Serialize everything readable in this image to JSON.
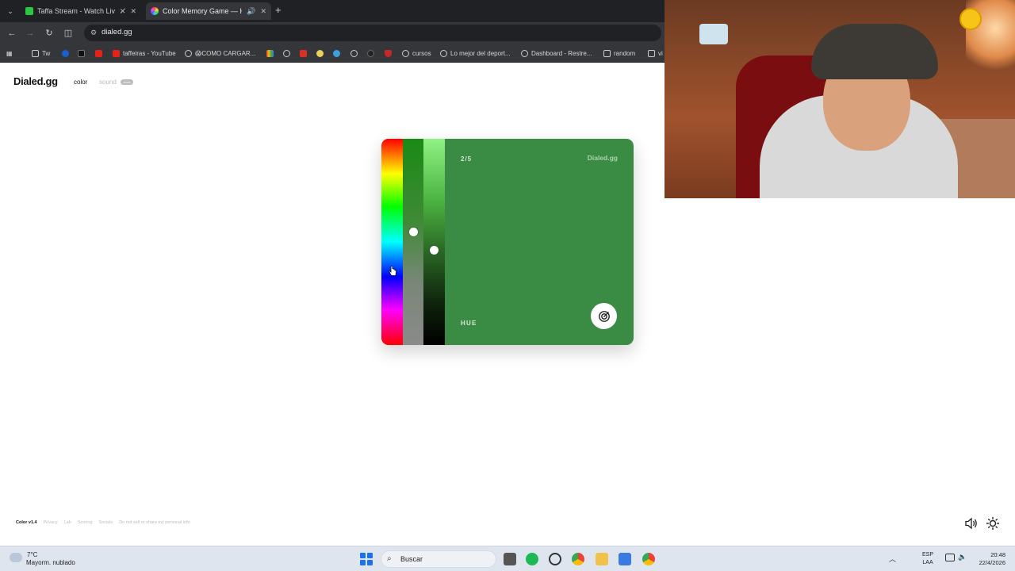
{
  "browser": {
    "tabs": [
      {
        "title": "Taffa Stream - Watch Live o",
        "favicon_color": "#28c840",
        "muted": true,
        "active": false
      },
      {
        "title": "Color Memory Game — Ho",
        "favicon_color": "#e6a23c",
        "audio": true,
        "active": true
      }
    ],
    "url": "dialed.gg",
    "bookmarks": [
      {
        "label": "Tw",
        "icon": "folder-icon"
      },
      {
        "label": "",
        "icon": "pepsi-icon"
      },
      {
        "label": "",
        "icon": "tiktok-icon"
      },
      {
        "label": "",
        "icon": "youtube-icon"
      },
      {
        "label": "taffeiras - YouTube",
        "icon": "youtube-icon"
      },
      {
        "label": "😱COMO CARGAR...",
        "icon": "globe-icon"
      },
      {
        "label": "",
        "icon": "gmail-icon"
      },
      {
        "label": "",
        "icon": "globe-icon"
      },
      {
        "label": "",
        "icon": "red-icon"
      },
      {
        "label": "",
        "icon": "yellow-icon"
      },
      {
        "label": "",
        "icon": "blue-icon"
      },
      {
        "label": "",
        "icon": "globe-icon"
      },
      {
        "label": "",
        "icon": "dark-icon"
      },
      {
        "label": "",
        "icon": "shield-icon"
      },
      {
        "label": "cursos",
        "icon": "globe-icon"
      },
      {
        "label": "Lo mejor del deport...",
        "icon": "globe-icon"
      },
      {
        "label": "Dashboard - Restre...",
        "icon": "globe-icon"
      },
      {
        "label": "random",
        "icon": "folder-icon"
      },
      {
        "label": "vi",
        "icon": "folder-icon"
      }
    ]
  },
  "site": {
    "logo": "Dialed.gg",
    "nav_color": "color",
    "nav_sound": "sound",
    "nav_soon": "soon"
  },
  "game": {
    "round": "2/5",
    "brand": "Dialed.gg",
    "mode": "HUE",
    "swatch_color": "#3a8c44",
    "hue_level": 0.46,
    "saturation_level": 0.5,
    "lightness_level": 0.3
  },
  "footer": {
    "version": "Color v1.4",
    "links": [
      "Privacy",
      "Lab",
      "Scoring",
      "Socials",
      "Do not sell or share my personal info"
    ]
  },
  "taskbar": {
    "weather_temp": "7°C",
    "weather_desc": "Mayorm. nublado",
    "search": "Buscar",
    "lang_line1": "ESP",
    "lang_line2": "LAA",
    "time": "20:48",
    "date": "22/4/2026"
  }
}
